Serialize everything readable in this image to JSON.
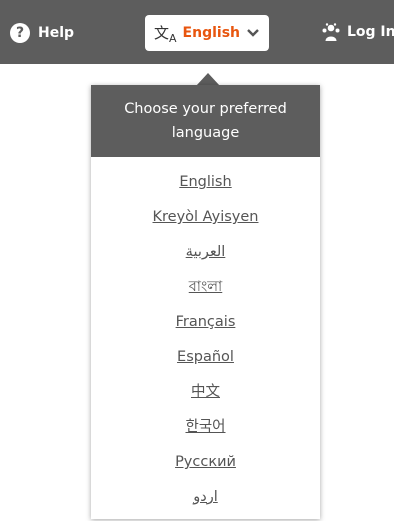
{
  "header": {
    "help_label": "Help",
    "help_icon": "question-circle-icon",
    "language_button_label": "English",
    "language_icon": "translate-icon",
    "language_icon_text": "文",
    "language_icon_sub": "A",
    "login_label": "Log In",
    "login_icon": "users-icon"
  },
  "language_menu": {
    "title": "Choose your preferred language",
    "options": [
      {
        "label": "English"
      },
      {
        "label": "Kreyòl Ayisyen"
      },
      {
        "label": "العربية"
      },
      {
        "label": "বাংলা"
      },
      {
        "label": "Français"
      },
      {
        "label": "Español"
      },
      {
        "label": "中文"
      },
      {
        "label": "한국어"
      },
      {
        "label": "Русский"
      },
      {
        "label": "اردو"
      }
    ]
  },
  "colors": {
    "header_bg": "#5d5d5d",
    "accent": "#e8560f",
    "link": "#555555"
  }
}
